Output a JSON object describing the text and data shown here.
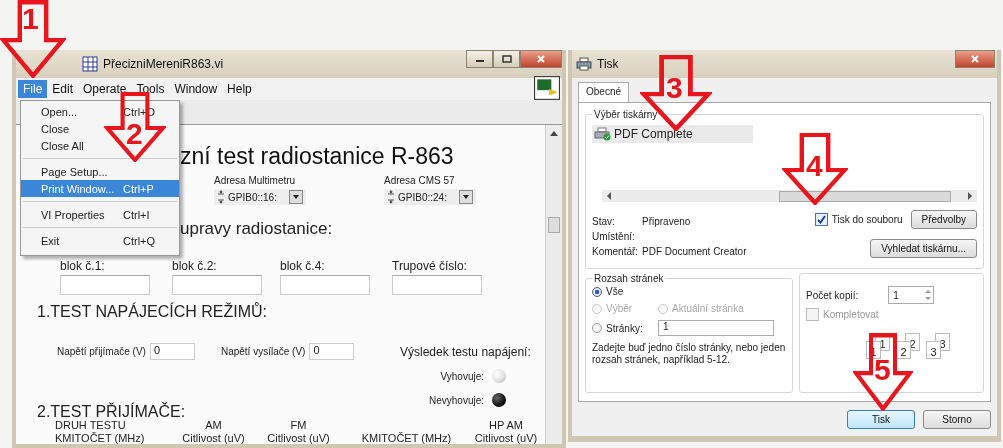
{
  "annotations": [
    {
      "label": "1"
    },
    {
      "label": "2"
    },
    {
      "label": "3"
    },
    {
      "label": "4"
    },
    {
      "label": "5"
    }
  ],
  "vi_window": {
    "title": "PřecizniMereniR863.vi",
    "menu": [
      {
        "label": "File",
        "selected": true
      },
      {
        "label": "Edit",
        "selected": false
      },
      {
        "label": "Operate",
        "selected": false
      },
      {
        "label": "Tools",
        "selected": false
      },
      {
        "label": "Window",
        "selected": false
      },
      {
        "label": "Help",
        "selected": false
      }
    ],
    "file_menu": [
      [
        {
          "label": "Open...",
          "shortcut": "Ctrl+O",
          "selected": false
        },
        {
          "label": "Close",
          "selected": false
        },
        {
          "label": "Close All",
          "selected": false
        }
      ],
      [
        {
          "label": "Page Setup...",
          "selected": false
        },
        {
          "label": "Print Window...",
          "shortcut": "Ctrl+P",
          "selected": true
        }
      ],
      [
        {
          "label": "VI Properties",
          "shortcut": "Ctrl+I",
          "selected": false
        }
      ],
      [
        {
          "label": "Exit",
          "shortcut": "Ctrl+Q",
          "selected": false
        }
      ]
    ],
    "panel": {
      "heading": "zní test radiostanice R-863",
      "address_fields": [
        {
          "label": "Adresa Multimetru",
          "value": "GPIB0::16:"
        },
        {
          "label": "Adresa CMS 57",
          "value": "GPIB0::24:"
        }
      ],
      "section_heading": "upravy radiostanice:",
      "block_fields": [
        {
          "label": "blok č.1:"
        },
        {
          "label": "blok č.2:"
        },
        {
          "label": "blok č.4:"
        },
        {
          "label": "Trupové číslo:"
        }
      ],
      "power_test": {
        "heading": "1.TEST NAPÁJECÍCH REŽIMŮ:",
        "inputs": [
          {
            "label": "Napětí přijímače  (V)",
            "value": "0"
          },
          {
            "label": "Napětí vysílače  (V)",
            "value": "0"
          }
        ],
        "result_label": "Výsledek testu napájení:",
        "leds": [
          {
            "label": "Vyhovuje:",
            "on": true
          },
          {
            "label": "Nevyhovuje:",
            "on": false
          }
        ]
      },
      "receiver_test": {
        "heading": "2.TEST PŘIJÍMAČE:",
        "columns": [
          {
            "top": "DRUH TESTU",
            "bottom": "KMITOČET (MHz)"
          },
          {
            "top": "AM",
            "bottom": "Citlivost (uV)"
          },
          {
            "top": "FM",
            "bottom": "Citlivost (uV)"
          },
          {
            "bottom": "KMITOČET (MHz)"
          },
          {
            "top": "HP AM",
            "bottom": "Citlivost (uV)"
          }
        ]
      }
    }
  },
  "print_dialog": {
    "title": "Tisk",
    "tabs": [
      {
        "label": "Obecné",
        "selected": true
      }
    ],
    "printer_group": {
      "legend": "Výběr tiskárny",
      "printers": [
        {
          "name": "PDF Complete",
          "selected": true
        }
      ],
      "status_rows": [
        {
          "label": "Stav:",
          "value": "Připraveno"
        },
        {
          "label": "Umístění:"
        },
        {
          "label": "Komentář:",
          "value": "PDF Document Creator"
        }
      ],
      "print_to_file": {
        "label": "Tisk do souboru",
        "checked": true
      },
      "buttons": [
        "Předvolby",
        "Vyhledat tiskárnu..."
      ]
    },
    "range_group": {
      "legend": "Rozsah stránek",
      "options": [
        {
          "label": "Vše",
          "selected": true,
          "disabled": false
        },
        {
          "label": "Výběr",
          "selected": false,
          "disabled": true
        },
        {
          "label": "Aktuální stránka",
          "selected": false,
          "disabled": true
        },
        {
          "label": "Stránky:",
          "selected": false,
          "disabled": false
        }
      ],
      "pages_value": "1",
      "hint": "Zadejte buď jedno číslo stránky, nebo jeden rozsah stránek, například 5-12."
    },
    "copies_group": {
      "label": "Počet kopií:",
      "value": "1",
      "collate": {
        "label": "Kompletovat",
        "checked": false,
        "disabled": true
      },
      "collate_pages": [
        {
          "back": "1",
          "front": "1"
        },
        {
          "back": "2",
          "front": "2"
        },
        {
          "back": "3",
          "front": "3"
        }
      ]
    },
    "buttons": [
      {
        "label": "Tisk",
        "default": true
      },
      {
        "label": "Storno",
        "default": false
      }
    ]
  }
}
